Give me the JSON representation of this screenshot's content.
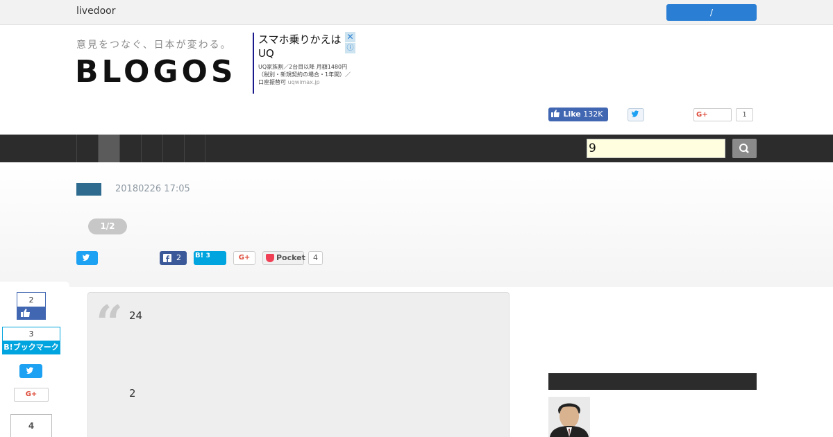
{
  "topbar": {
    "brand": "livedoor",
    "login_label": "/"
  },
  "header": {
    "tagline": "意見をつなぐ、日本が変わる。",
    "logo": "BLOGOS"
  },
  "ad": {
    "title": "スマホ乗りかえはUQ",
    "body": "UQ家族割／2台目以降 月額1480円（税別・新規契約の場合・1年間）／口座振替可",
    "url": "uqwimax.jp",
    "close_icon": "close-icon",
    "info_icon": "info-icon"
  },
  "social_top": {
    "fb_like_label": "Like",
    "fb_like_count": "132K",
    "gplus_label": "G+",
    "gplus_count": "1"
  },
  "navbar": {
    "search_value": "9",
    "search_icon": "search-icon"
  },
  "article": {
    "date": "20180226 17:05",
    "page_indicator": "1/2",
    "quote_line1": "24",
    "quote_line2": "2",
    "quote_mark": "“"
  },
  "share_bar": {
    "fb_count": "2",
    "hatena_label": "B!",
    "hatena_count": "3",
    "gplus_label": "G+",
    "pocket_label": "Pocket",
    "pocket_count": "4"
  },
  "left_rail": {
    "fb_count": "2",
    "hatena_count": "3",
    "hatena_label": "B!ブックマーク",
    "gplus_label": "G+",
    "pocket_count": "4"
  },
  "colors": {
    "navbar": "#2c2c2c",
    "login_button": "#2a7fd4",
    "facebook": "#4267b2",
    "twitter": "#1da1f2",
    "hatena": "#00a4de",
    "category_tag": "#2e6b8f"
  }
}
